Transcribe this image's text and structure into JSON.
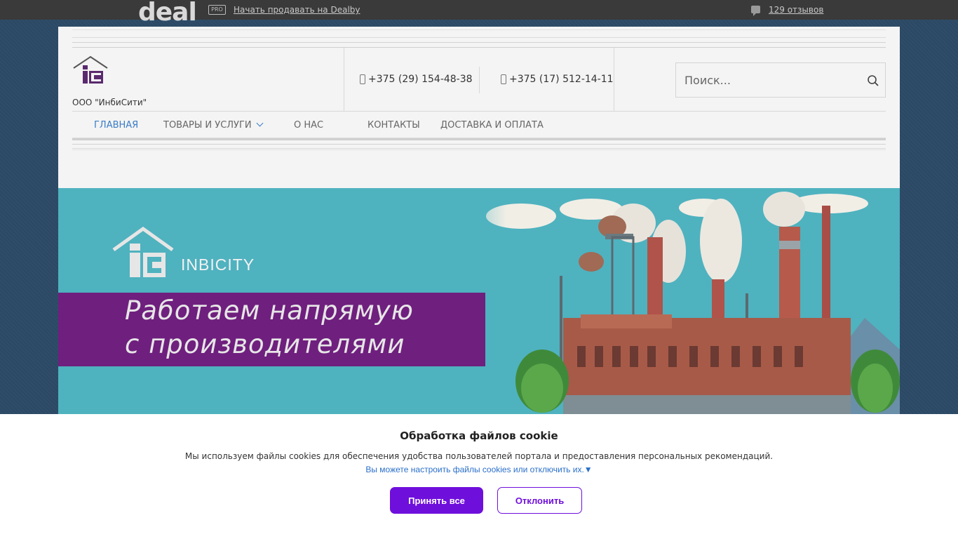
{
  "topbar": {
    "logo_text": "deal",
    "pro_badge": "PRO",
    "sell_link": "Начать продавать на Dealby",
    "reviews_link": "129 отзывов"
  },
  "header": {
    "company_name": "ООО \"ИнбиСити\"",
    "phone_1": "+375 (29) 154-48-38",
    "phone_2": "+375 (17) 512-14-11",
    "search_placeholder": "Поиск..."
  },
  "nav": {
    "items": [
      {
        "label": "Главная",
        "active": true
      },
      {
        "label": "Товары и услуги",
        "has_dropdown": true
      },
      {
        "label": "О нас"
      },
      {
        "label": "Контакты"
      },
      {
        "label": "Доставка и оплата"
      }
    ]
  },
  "banner": {
    "brand": "INBICITY",
    "slogan_line_1": "Работаем напрямую",
    "slogan_line_2": "с производителями"
  },
  "cookie": {
    "title": "Обработка файлов cookie",
    "text": "Мы используем файлы cookies для обеспечения удобства пользователей портала и предоставления персональных рекомендаций.",
    "settings_link": "Вы можете настроить файлы cookies или отключить их.▼",
    "accept_label": "Принять все",
    "decline_label": "Отклонить"
  },
  "colors": {
    "accent_purple": "#6f0fdc",
    "nav_active": "#3a7cc7",
    "banner_band": "#6f1f7e",
    "banner_bg": "#4fb2bf"
  }
}
